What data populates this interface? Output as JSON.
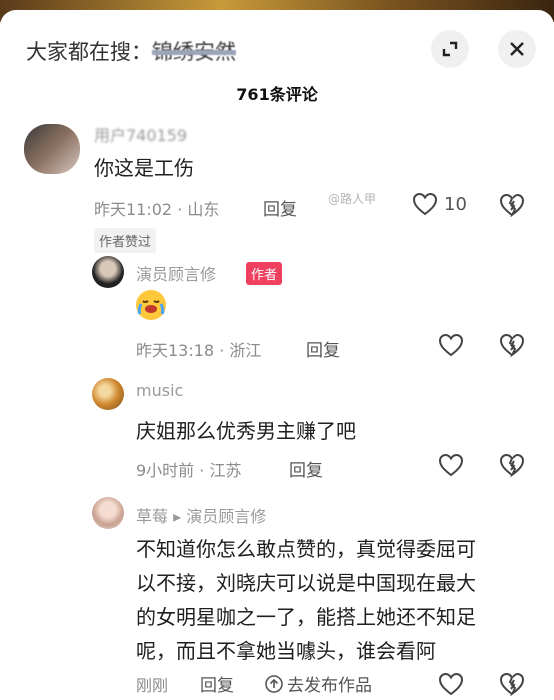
{
  "header": {
    "search_prefix": "大家都在搜：",
    "search_term": "锦绣安然"
  },
  "comment_count": "761条评论",
  "comments": [
    {
      "user": "用户740159",
      "text": "你这是工伤",
      "time": "昨天11:02 · 山东",
      "reply": "回复",
      "likes": "10",
      "badge": "作者赞过",
      "watermark": "@路人甲"
    },
    {
      "user": "演员顾言修",
      "author_tag": "作者",
      "time": "昨天13:18 · 浙江",
      "reply": "回复"
    },
    {
      "user": "music",
      "text": "庆姐那么优秀男主赚了吧",
      "time": "9小时前 · 江苏",
      "reply": "回复"
    },
    {
      "user": "草莓",
      "reply_to": "演员顾言修",
      "text_lines": [
        "不知道你怎么敢点赞的，真觉得委屈可",
        "以不接，刘晓庆可以说是中国现在最大",
        "的女明星咖之一了，能搭上她还不知足",
        "呢，而且不拿她当噱头，谁会看阿"
      ],
      "time": "刚刚",
      "reply": "回复",
      "share": "去发布作品"
    }
  ],
  "colors": {
    "author_tag": "#f04060",
    "meta": "#8c8c8c"
  }
}
